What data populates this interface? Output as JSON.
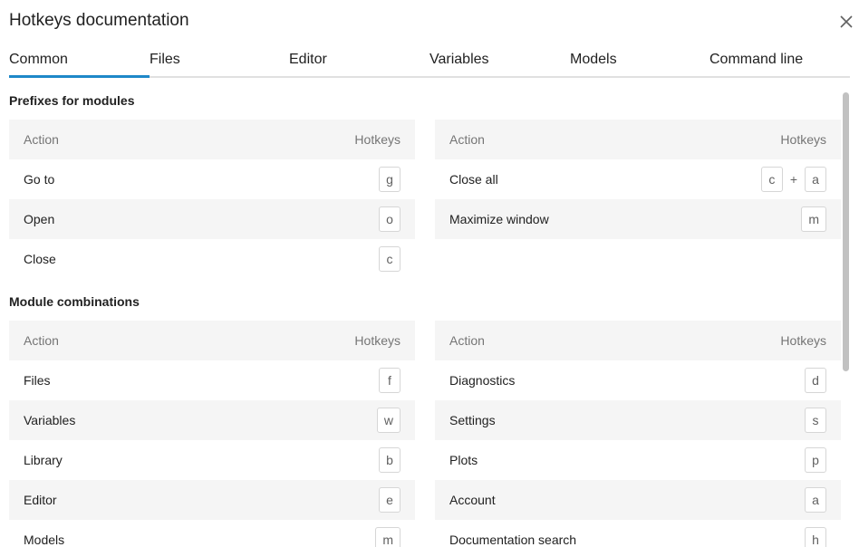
{
  "dialog": {
    "title": "Hotkeys documentation"
  },
  "tabs": [
    {
      "label": "Common"
    },
    {
      "label": "Files"
    },
    {
      "label": "Editor"
    },
    {
      "label": "Variables"
    },
    {
      "label": "Models"
    },
    {
      "label": "Command line"
    }
  ],
  "sections": [
    {
      "title": "Prefixes for modules",
      "left": {
        "col_action": "Action",
        "col_hotkeys": "Hotkeys",
        "rows": [
          {
            "action": "Go to",
            "keys": [
              "g"
            ]
          },
          {
            "action": "Open",
            "keys": [
              "o"
            ]
          },
          {
            "action": "Close",
            "keys": [
              "c"
            ]
          }
        ]
      },
      "right": {
        "col_action": "Action",
        "col_hotkeys": "Hotkeys",
        "rows": [
          {
            "action": "Close all",
            "keys": [
              "c",
              "a"
            ],
            "joiner": "+"
          },
          {
            "action": "Maximize window",
            "keys": [
              "m"
            ]
          }
        ]
      }
    },
    {
      "title": "Module combinations",
      "left": {
        "col_action": "Action",
        "col_hotkeys": "Hotkeys",
        "rows": [
          {
            "action": "Files",
            "keys": [
              "f"
            ]
          },
          {
            "action": "Variables",
            "keys": [
              "w"
            ]
          },
          {
            "action": "Library",
            "keys": [
              "b"
            ]
          },
          {
            "action": "Editor",
            "keys": [
              "e"
            ]
          },
          {
            "action": "Models",
            "keys": [
              "m"
            ]
          }
        ]
      },
      "right": {
        "col_action": "Action",
        "col_hotkeys": "Hotkeys",
        "rows": [
          {
            "action": "Diagnostics",
            "keys": [
              "d"
            ]
          },
          {
            "action": "Settings",
            "keys": [
              "s"
            ]
          },
          {
            "action": "Plots",
            "keys": [
              "p"
            ]
          },
          {
            "action": "Account",
            "keys": [
              "a"
            ]
          },
          {
            "action": "Documentation search",
            "keys": [
              "h"
            ]
          }
        ]
      }
    }
  ],
  "icons": {
    "close": "close-icon"
  },
  "colors": {
    "accent": "#1e88c8",
    "row_shade": "#f5f5f5"
  }
}
